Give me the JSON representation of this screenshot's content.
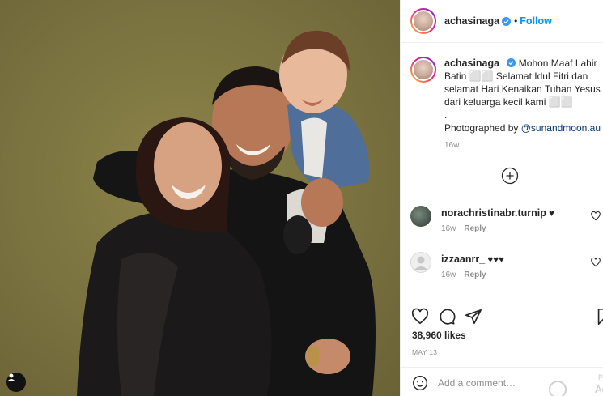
{
  "post": {
    "username": "achasinaga",
    "follow_label": "Follow",
    "separator": "•"
  },
  "caption": {
    "username": "achasinaga",
    "body": "Mohon Maaf Lahir Batin ⬜⬜ Selamat Idul Fitri dan selamat Hari Kenaikan Tuhan Yesus dari keluarga kecil kami ⬜⬜",
    "dot_line": ".",
    "credit_prefix": "Photographed by ",
    "credit_handle": "@sunandmoon.au",
    "time": "16w"
  },
  "comments": [
    {
      "username": "norachristinabr.turnip",
      "text": "♥",
      "time": "16w",
      "reply": "Reply"
    },
    {
      "username": "izzaanrr_",
      "text": "♥♥♥",
      "time": "16w",
      "reply": "Reply"
    }
  ],
  "engagement": {
    "likes": "38,960 likes",
    "date": "MAY 13"
  },
  "composer": {
    "placeholder": "Add a comment…"
  },
  "watermark": {
    "text_1": "Po",
    "text_2": "Ac"
  },
  "colors": {
    "link_blue": "#0095f6",
    "backdrop": "#7d7541"
  },
  "icons": {
    "verified": "verified-badge-icon",
    "user_tag": "user-tag-icon",
    "load_more": "plus-circle-icon",
    "like": "heart-icon",
    "comment": "comment-bubble-icon",
    "share": "paper-plane-icon",
    "save": "bookmark-icon",
    "emoji": "emoji-icon"
  }
}
